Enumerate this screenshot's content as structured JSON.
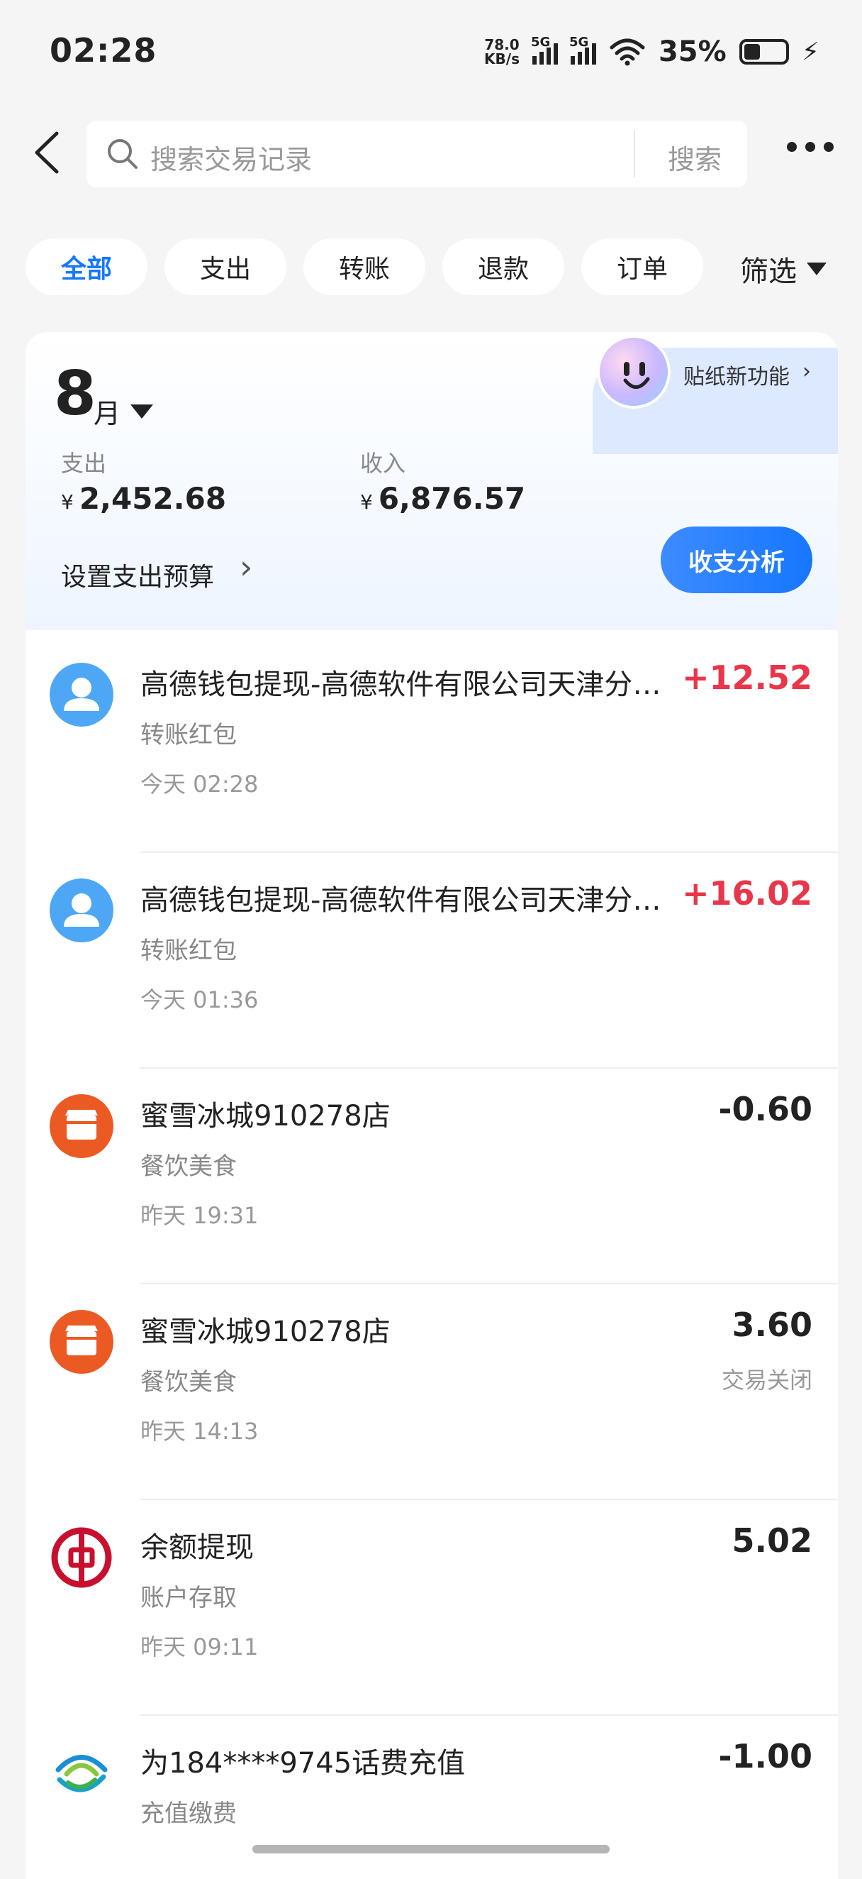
{
  "status_bar": {
    "time": "02:28",
    "net_speed_value": "78.0",
    "net_speed_unit": "KB/s",
    "signal1": "5G",
    "signal2": "5G",
    "battery": "35%"
  },
  "search": {
    "placeholder": "搜索交易记录",
    "button": "搜索"
  },
  "tabs": [
    "全部",
    "支出",
    "转账",
    "退款",
    "订单"
  ],
  "filter_label": "筛选",
  "summary": {
    "month_number": "8",
    "month_unit": "月",
    "expense_label": "支出",
    "expense_currency": "¥",
    "expense_value": "2,452.68",
    "income_label": "收入",
    "income_currency": "¥",
    "income_value": "6,876.57",
    "budget_label": "设置支出预算",
    "analysis_button": "收支分析",
    "sticker_label": "贴纸新功能"
  },
  "transactions": [
    {
      "icon": "person-icon",
      "title": "高德钱包提现-高德软件有限公司天津分公司",
      "category": "转账红包",
      "date": "今天 02:28",
      "amount": "+12.52",
      "status": ""
    },
    {
      "icon": "person-icon",
      "title": "高德钱包提现-高德软件有限公司天津分公司",
      "category": "转账红包",
      "date": "今天 01:36",
      "amount": "+16.02",
      "status": ""
    },
    {
      "icon": "store-icon",
      "title": "蜜雪冰城910278店",
      "category": "餐饮美食",
      "date": "昨天 19:31",
      "amount": "-0.60",
      "status": ""
    },
    {
      "icon": "store-icon",
      "title": "蜜雪冰城910278店",
      "category": "餐饮美食",
      "date": "昨天 14:13",
      "amount": "3.60",
      "status": "交易关闭"
    },
    {
      "icon": "bank-of-china-icon",
      "title": "余额提现",
      "category": "账户存取",
      "date": "昨天 09:11",
      "amount": "5.02",
      "status": ""
    },
    {
      "icon": "china-mobile-icon",
      "title": "为184****9745话费充值",
      "category": "充值缴费",
      "date": "",
      "amount": "-1.00",
      "status": ""
    }
  ],
  "colors": {
    "accent": "#1677ff",
    "income": "#e8364a",
    "person_icon": "#4ea7f5",
    "store_icon": "#ec5a24",
    "bank_icon": "#c8102e"
  }
}
